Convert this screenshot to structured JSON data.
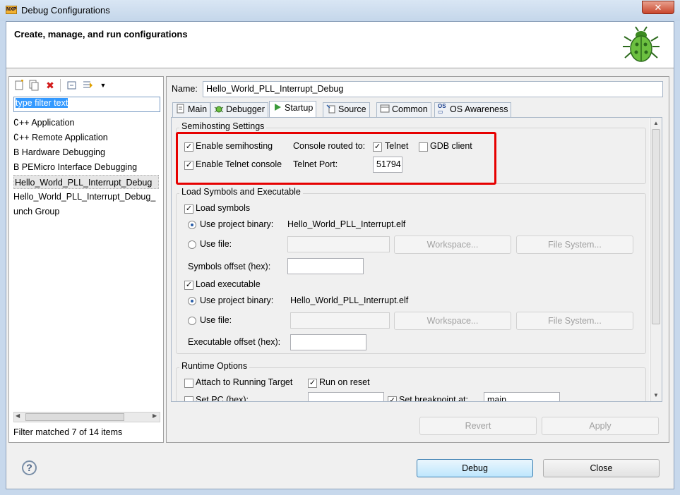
{
  "window": {
    "title": "Debug Configurations",
    "close_glyph": "✕",
    "logo_text": "NXP"
  },
  "banner": {
    "title": "Create, manage, and run configurations"
  },
  "left": {
    "toolbar_icons": [
      "new-config-icon",
      "duplicate-icon",
      "delete-icon",
      "collapse-all-icon",
      "filter-icon",
      "dropdown-arrow-icon"
    ],
    "filter_placeholder": "type filter text",
    "tree": [
      "C++ Application",
      "C++ Remote Application",
      "B Hardware Debugging",
      "B PEMicro Interface Debugging",
      "Hello_World_PLL_Interrupt_Debug",
      "Hello_World_PLL_Interrupt_Debug_",
      "unch Group"
    ],
    "tree_display": [
      "∁++ Application",
      "∁++ Remote Application",
      "B Hardware Debugging",
      "B PEMicro Interface Debugging",
      "Hello_World_PLL_Interrupt_Debug",
      "Hello_World_PLL_Interrupt_Debug_",
      "unch Group"
    ],
    "status": "Filter matched 7 of 14 items"
  },
  "right": {
    "name_label": "Name:",
    "name_value": "Hello_World_PLL_Interrupt_Debug",
    "tabs": [
      "Main",
      "Debugger",
      "Startup",
      "Source",
      "Common",
      "OS Awareness"
    ],
    "active_tab": "Startup",
    "semihosting": {
      "title": "Semihosting Settings",
      "enable_semihosting": "Enable semihosting",
      "console_routed": "Console routed to:",
      "telnet": "Telnet",
      "gdb_client": "GDB client",
      "enable_telnet": "Enable Telnet console",
      "telnet_port_label": "Telnet Port:",
      "telnet_port": "51794"
    },
    "load": {
      "title": "Load Symbols and Executable",
      "load_symbols": "Load symbols",
      "use_project_binary": "Use project binary:",
      "symbols_binary": "Hello_World_PLL_Interrupt.elf",
      "use_file": "Use file:",
      "workspace": "Workspace...",
      "file_system": "File System...",
      "symbols_offset": "Symbols offset (hex):",
      "load_executable": "Load executable",
      "exec_binary": "Hello_World_PLL_Interrupt.elf",
      "exec_offset": "Executable offset (hex):"
    },
    "runtime": {
      "title": "Runtime Options",
      "attach": "Attach to Running Target",
      "run_on_reset": "Run on reset",
      "set_pc": "Set PC (hex):",
      "set_breakpoint": "Set breakpoint at:",
      "breakpoint_value": "main"
    },
    "revert": "Revert",
    "apply": "Apply"
  },
  "footer": {
    "help": "?",
    "debug": "Debug",
    "close": "Close"
  },
  "colors": {
    "highlight_box": "#e60000",
    "selection": "#3399ff"
  }
}
